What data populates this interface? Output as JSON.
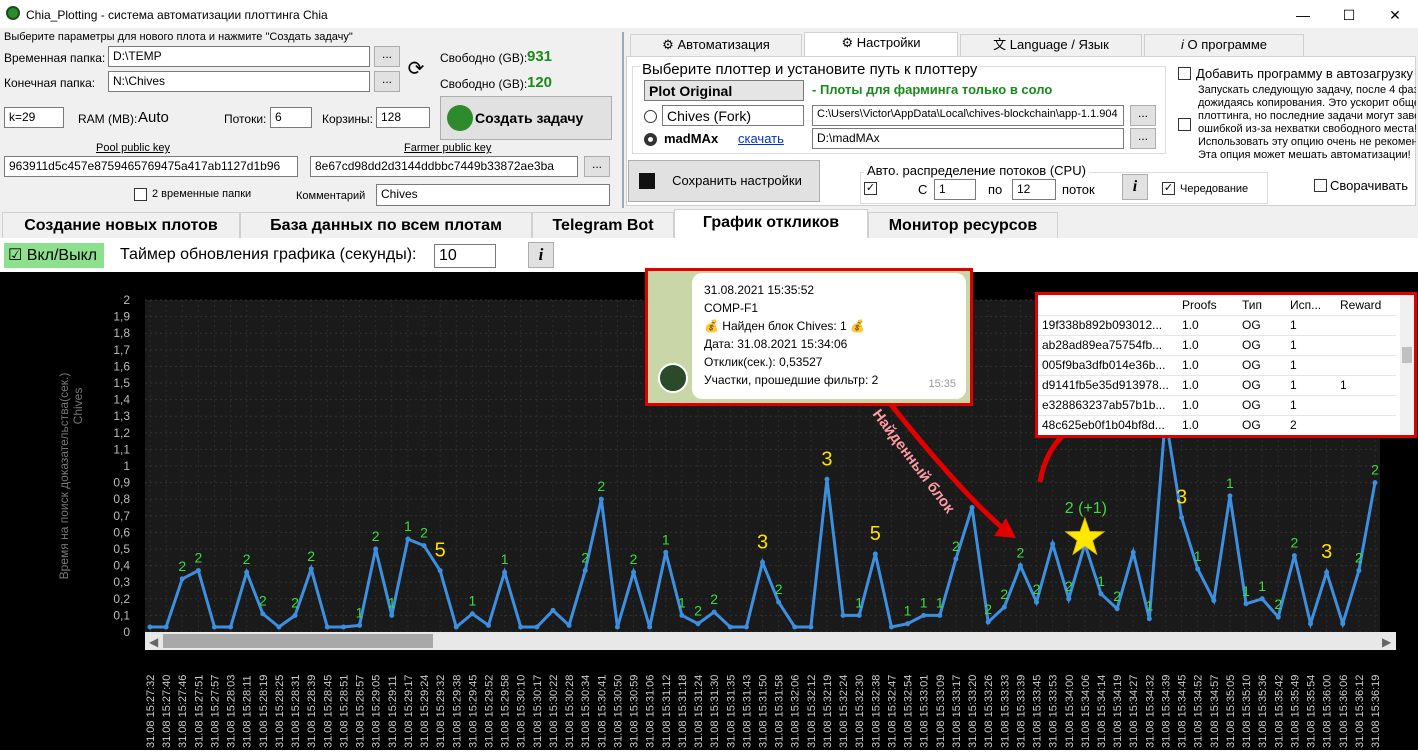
{
  "window": {
    "title": "Chia_Plotting - система автоматизации плоттинга Chia",
    "min": "—",
    "max": "☐",
    "close": "✕"
  },
  "left": {
    "heading": "Выберите параметры для нового плота и нажмите \"Создать задачу\"",
    "temp_label": "Временная папка:",
    "temp_value": "D:\\TEMP",
    "final_label": "Конечная папка:",
    "final_value": "N:\\Chives",
    "free_label": "Свободно (GB):",
    "free_temp": "931",
    "free_final": "120",
    "k_value": "k=29",
    "ram_label": "RAM (MB):",
    "ram_value": "Auto",
    "threads_label": "Потоки:",
    "threads_value": "6",
    "buckets_label": "Корзины:",
    "buckets_value": "128",
    "create_label": "Создать задачу",
    "pool_key_label": "Pool public key",
    "pool_key": "963911d5c457e8759465769475a417ab1127d1b96",
    "farmer_key_label": "Farmer public key",
    "farmer_key": "8e67cd98dd2d3144ddbbc7449b33872ae3ba",
    "two_temp_label": "2 временные папки",
    "comment_label": "Комментарий",
    "comment_value": "Chives",
    "browse": "..."
  },
  "tabs": [
    "Автоматизация",
    "Настройки",
    "Language / Язык",
    "О программе"
  ],
  "settings": {
    "group_title": "Выберите плоттер и установите путь к плоттеру",
    "plotter_select": "Plot Original",
    "solo_note": "- Плоты для фарминга только в соло",
    "fork_select": "Chives (Fork)",
    "fork_path": "C:\\Users\\Victor\\AppData\\Local\\chives-blockchain\\app-1.1.904",
    "madmax_label": "madMAx",
    "download_link": "скачать",
    "madmax_path": "D:\\madMAx",
    "save_label": "Сохранить настройки",
    "cpu_title": "Авто. распределение потоков (CPU)",
    "from_label": "С",
    "from_value": "1",
    "to_label": "по",
    "to_value": "12",
    "threads_word": "поток",
    "alternate_label": "Чередование",
    "autostart_label": "Добавить программу в автозагрузку",
    "autostart_desc": [
      "Запускать следующую задачу, после 4 фазы,",
      "дожидаясь копирования. Это ускорит общее",
      "плоттинга, но последние задачи могут заве",
      "ошибкой из-за нехватки свободного места!",
      "Использовать эту опцию очень не рекомен",
      "Эта опция может мешать автоматизации!"
    ],
    "minimize_label": "Сворачивать"
  },
  "main_tabs": [
    "Создание новых плотов",
    "База данных по всем плотам",
    "Telegram Bot",
    "График откликов",
    "Монитор ресурсов"
  ],
  "chart_controls": {
    "toggle_label": "Вкл/Выкл",
    "timer_label": "Таймер обновления графика (секунды):",
    "timer_value": "10",
    "info": "i"
  },
  "telegram": {
    "lines": [
      "31.08.2021 15:35:52",
      "COMP-F1",
      "💰 Найден блок Chives: 1 💰",
      "Дата: 31.08.2021 15:34:06",
      "Отклик(сек.): 0,53527",
      "Участки, прошедшие фильтр: 2"
    ],
    "time": "15:35"
  },
  "table": {
    "headers": [
      "",
      "Proofs",
      "Тип",
      "Исп...",
      "Reward"
    ],
    "rows": [
      [
        "19f338b892b093012...",
        "1.0",
        "OG",
        "1",
        ""
      ],
      [
        "ab28ad89ea75754fb...",
        "1.0",
        "OG",
        "1",
        ""
      ],
      [
        "005f9ba3dfb014e36b...",
        "1.0",
        "OG",
        "1",
        ""
      ],
      [
        "d9141fb5e35d913978...",
        "1.0",
        "OG",
        "1",
        "1"
      ],
      [
        "e328863237ab57b1b...",
        "1.0",
        "OG",
        "1",
        ""
      ],
      [
        "48c625eb0f1b04bf8d...",
        "1.0",
        "OG",
        "2",
        ""
      ]
    ]
  },
  "annotation": {
    "found_block": "Найденный блок",
    "star_label": "2 (+1)"
  },
  "chart_data": {
    "type": "line",
    "ylabel": "Время на поиск доказательства(сек.)",
    "series_label": "Chives",
    "ylim": [
      0,
      2
    ],
    "yticks": [
      "0",
      "0,1",
      "0,2",
      "0,3",
      "0,4",
      "0,5",
      "0,6",
      "0,7",
      "0,8",
      "0,9",
      "1",
      "1,1",
      "1,2",
      "1,3",
      "1,4",
      "1,5",
      "1,6",
      "1,7",
      "1,8",
      "1,9",
      "2"
    ],
    "x": [
      "31.08 15:27:32",
      "31.08 15:27:40",
      "31.08 15:27:46",
      "31.08 15:27:51",
      "31.08 15:27:57",
      "31.08 15:28:03",
      "31.08 15:28:11",
      "31.08 15:28:19",
      "31.08 15:28:25",
      "31.08 15:28:31",
      "31.08 15:28:39",
      "31.08 15:28:45",
      "31.08 15:28:51",
      "31.08 15:28:57",
      "31.08 15:29:05",
      "31.08 15:29:11",
      "31.08 15:29:17",
      "31.08 15:29:24",
      "31.08 15:29:32",
      "31.08 15:29:38",
      "31.08 15:29:45",
      "31.08 15:29:52",
      "31.08 15:29:58",
      "31.08 15:30:10",
      "31.08 15:30:17",
      "31.08 15:30:22",
      "31.08 15:30:28",
      "31.08 15:30:34",
      "31.08 15:30:41",
      "31.08 15:30:50",
      "31.08 15:30:59",
      "31.08 15:31:06",
      "31.08 15:31:12",
      "31.08 15:31:18",
      "31.08 15:31:24",
      "31.08 15:31:30",
      "31.08 15:31:35",
      "31.08 15:31:43",
      "31.08 15:31:50",
      "31.08 15:31:58",
      "31.08 15:32:06",
      "31.08 15:32:12",
      "31.08 15:32:19",
      "31.08 15:32:24",
      "31.08 15:32:30",
      "31.08 15:32:38",
      "31.08 15:32:47",
      "31.08 15:32:54",
      "31.08 15:33:01",
      "31.08 15:33:09",
      "31.08 15:33:17",
      "31.08 15:33:20",
      "31.08 15:33:26",
      "31.08 15:33:33",
      "31.08 15:33:39",
      "31.08 15:33:45",
      "31.08 15:33:53",
      "31.08 15:34:00",
      "31.08 15:34:06",
      "31.08 15:34:14",
      "31.08 15:34:19",
      "31.08 15:34:27",
      "31.08 15:34:32",
      "31.08 15:34:39",
      "31.08 15:34:45",
      "31.08 15:34:52",
      "31.08 15:34:57",
      "31.08 15:35:05",
      "31.08 15:35:10",
      "31.08 15:35:36",
      "31.08 15:35:42",
      "31.08 15:35:49",
      "31.08 15:35:54",
      "31.08 15:36:00",
      "31.08 15:36:06",
      "31.08 15:36:12",
      "31.08 15:36:19"
    ],
    "values": [
      0.03,
      0.03,
      0.32,
      0.37,
      0.03,
      0.03,
      0.36,
      0.11,
      0.03,
      0.1,
      0.38,
      0.03,
      0.03,
      0.04,
      0.5,
      0.1,
      0.56,
      0.52,
      0.37,
      0.03,
      0.11,
      0.04,
      0.36,
      0.03,
      0.03,
      0.13,
      0.04,
      0.37,
      0.8,
      0.03,
      0.36,
      0.03,
      0.48,
      0.1,
      0.05,
      0.12,
      0.03,
      0.03,
      0.42,
      0.18,
      0.03,
      0.03,
      0.92,
      0.1,
      0.1,
      0.47,
      0.03,
      0.05,
      0.1,
      0.1,
      0.44,
      0.75,
      0.06,
      0.15,
      0.4,
      0.18,
      0.53,
      0.2,
      0.53,
      0.23,
      0.14,
      0.48,
      0.08,
      1.3,
      0.69,
      0.38,
      0.19,
      0.82,
      0.17,
      0.2,
      0.09,
      0.46,
      0.05,
      0.36,
      0.05,
      0.37,
      0.9
    ],
    "labels": [
      "",
      "",
      "2",
      "2",
      "",
      "",
      "2",
      "2",
      "",
      "2",
      "2",
      "",
      "",
      "1",
      "2",
      "1",
      "1",
      "2",
      "5",
      "",
      "1",
      "",
      "1",
      "",
      "",
      "",
      "",
      "2",
      "2",
      "",
      "2",
      "",
      "1",
      "1",
      "2",
      "2",
      "",
      "",
      "3",
      "2",
      "",
      "",
      "3",
      "",
      "1",
      "5",
      "",
      "1",
      "1",
      "1",
      "2",
      "",
      "2",
      "2",
      "2",
      "2",
      "",
      "2",
      "1",
      "1",
      "2",
      "",
      "1",
      "1",
      "3",
      "1",
      "",
      "1",
      "1",
      "1",
      "2",
      "2",
      "",
      "3",
      "",
      "2",
      "2"
    ]
  }
}
